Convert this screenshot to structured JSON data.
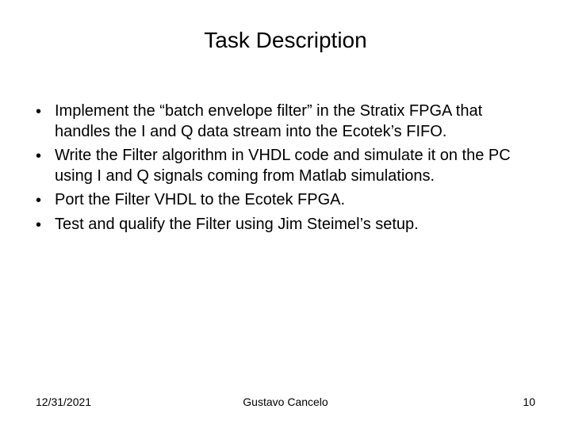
{
  "title": "Task Description",
  "bullets": [
    "Implement the “batch envelope filter” in the Stratix FPGA that handles the I and Q data stream into the Ecotek’s FIFO.",
    "Write the Filter algorithm in VHDL code and simulate it on the PC using I and Q signals coming from Matlab simulations.",
    "Port the Filter VHDL to the Ecotek FPGA.",
    "Test and qualify the Filter using Jim Steimel’s setup."
  ],
  "footer": {
    "date": "12/31/2021",
    "author": "Gustavo Cancelo",
    "page": "10"
  }
}
